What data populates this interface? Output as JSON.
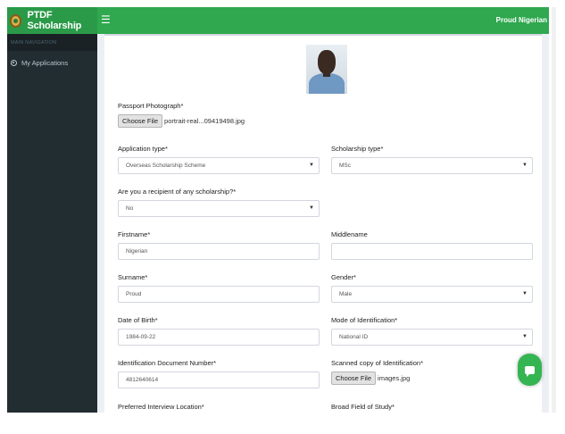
{
  "header": {
    "brand": "PTDF Scholarship",
    "menu_icon": "hamburger-icon",
    "user": "Proud Nigerian",
    "color": "#2fa84f"
  },
  "sidebar": {
    "nav_header": "MAIN NAVIGATION",
    "items": [
      {
        "label": "My Applications",
        "icon": "globe-icon"
      }
    ]
  },
  "form": {
    "passport": {
      "label": "Passport Photograph*",
      "button": "Choose File",
      "file": "portrait-real...09419498.jpg"
    },
    "application_type": {
      "label": "Application type*",
      "value": "Overseas Scholarship Scheme"
    },
    "scholarship_type": {
      "label": "Scholarship type*",
      "value": "MSc"
    },
    "recipient": {
      "label": "Are you a recipient of any scholarship?*",
      "value": "No"
    },
    "firstname": {
      "label": "Firstname*",
      "value": "Nigerian"
    },
    "middlename": {
      "label": "Middlename",
      "value": ""
    },
    "surname": {
      "label": "Surname*",
      "value": "Proud"
    },
    "gender": {
      "label": "Gender*",
      "value": "Male"
    },
    "dob": {
      "label": "Date of Birth*",
      "value": "1984-09-22"
    },
    "identification_mode": {
      "label": "Mode of Identification*",
      "value": "National ID"
    },
    "id_number": {
      "label": "Identification Document Number*",
      "value": "4812640614"
    },
    "id_copy": {
      "label": "Scanned copy of Identification*",
      "button": "Choose File",
      "file": "images.jpg"
    },
    "interview_location": {
      "label": "Preferred Interview Location*"
    },
    "field_of_study": {
      "label": "Broad Field of Study*"
    }
  },
  "chat_button": {
    "icon": "chat-icon",
    "color": "#35b552"
  }
}
